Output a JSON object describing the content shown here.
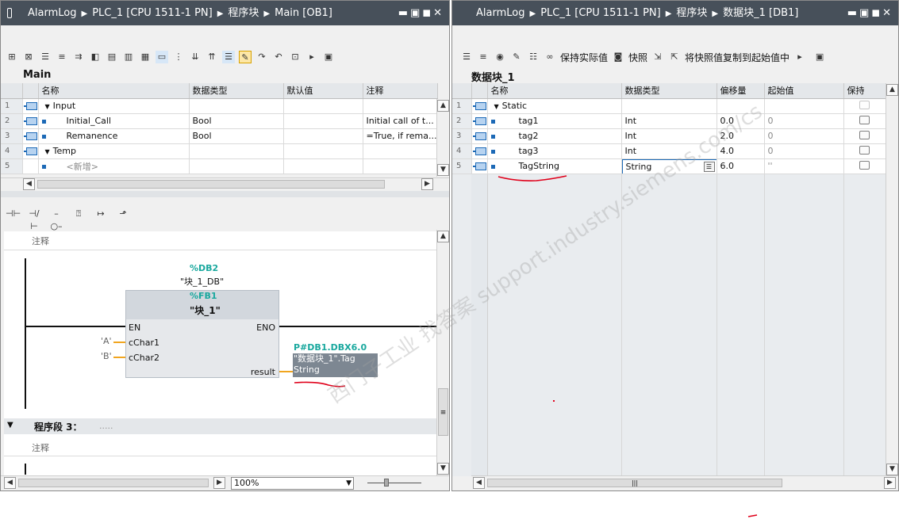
{
  "left": {
    "titlebar": {
      "app": "AlarmLog",
      "device": "PLC_1 [CPU 1511-1 PN]",
      "folder": "程序块",
      "block": "Main [OB1]"
    },
    "section_title": "Main",
    "interface": {
      "headers": [
        "名称",
        "数据类型",
        "默认值",
        "注释"
      ],
      "rows": [
        {
          "n": "1",
          "name": "Input",
          "type": "",
          "default": "",
          "comment": "",
          "level": 0,
          "expand": true
        },
        {
          "n": "2",
          "name": "Initial_Call",
          "type": "Bool",
          "default": "",
          "comment": "Initial call of t...",
          "level": 1,
          "expand": false
        },
        {
          "n": "3",
          "name": "Remanence",
          "type": "Bool",
          "default": "",
          "comment": "=True, if rema...",
          "level": 1,
          "expand": false
        },
        {
          "n": "4",
          "name": "Temp",
          "type": "",
          "default": "",
          "comment": "",
          "level": 0,
          "expand": true
        },
        {
          "n": "5",
          "name": "<新增>",
          "type": "",
          "default": "",
          "comment": "",
          "level": 1,
          "expand": false
        }
      ]
    },
    "ladder": {
      "comment_label": "注释",
      "db_addr": "%DB2",
      "db_name": "\"块_1_DB\"",
      "fb_addr": "%FB1",
      "fb_name": "\"块_1\"",
      "pin_en": "EN",
      "pin_eno": "ENO",
      "pin_c1": "cChar1",
      "pin_c2": "cChar2",
      "pin_result": "result",
      "val_a": "'A'",
      "val_b": "'B'",
      "out_addr": "P#DB1.DBX6.0",
      "out_tag_line1": "\"数据块_1\".Tag",
      "out_tag_line2": "String",
      "network_label": "程序段 3：",
      "network_dots": ".....",
      "comment_label2": "注释"
    },
    "zoom": "100%"
  },
  "right": {
    "titlebar": {
      "app": "AlarmLog",
      "device": "PLC_1 [CPU 1511-1 PN]",
      "folder": "程序块",
      "block": "数据块_1 [DB1]"
    },
    "toolbar": {
      "keep_actual": "保持实际值",
      "snapshot": "快照",
      "copy_snapshot": "将快照值复制到起始值中"
    },
    "section_title": "数据块_1",
    "table": {
      "headers": [
        "名称",
        "数据类型",
        "偏移量",
        "起始值",
        "保持"
      ],
      "rows": [
        {
          "n": "1",
          "name": "Static",
          "type": "",
          "offset": "",
          "start": "",
          "level": 0
        },
        {
          "n": "2",
          "name": "tag1",
          "type": "Int",
          "offset": "0.0",
          "start": "0",
          "level": 1
        },
        {
          "n": "3",
          "name": "tag2",
          "type": "Int",
          "offset": "2.0",
          "start": "0",
          "level": 1
        },
        {
          "n": "4",
          "name": "tag3",
          "type": "Int",
          "offset": "4.0",
          "start": "0",
          "level": 1
        },
        {
          "n": "5",
          "name": "TagString",
          "type": "String",
          "offset": "6.0",
          "start": "''",
          "level": 1
        }
      ]
    }
  },
  "watermark": "西门子工业  找答案  support.industry.siemens.com/cs",
  "colors": {
    "titlebar": "#47505a",
    "accent_blue": "#1c69b6",
    "teal": "#19a89e",
    "wire_orange": "#f1a51f",
    "annotation_red": "#e0001a"
  }
}
